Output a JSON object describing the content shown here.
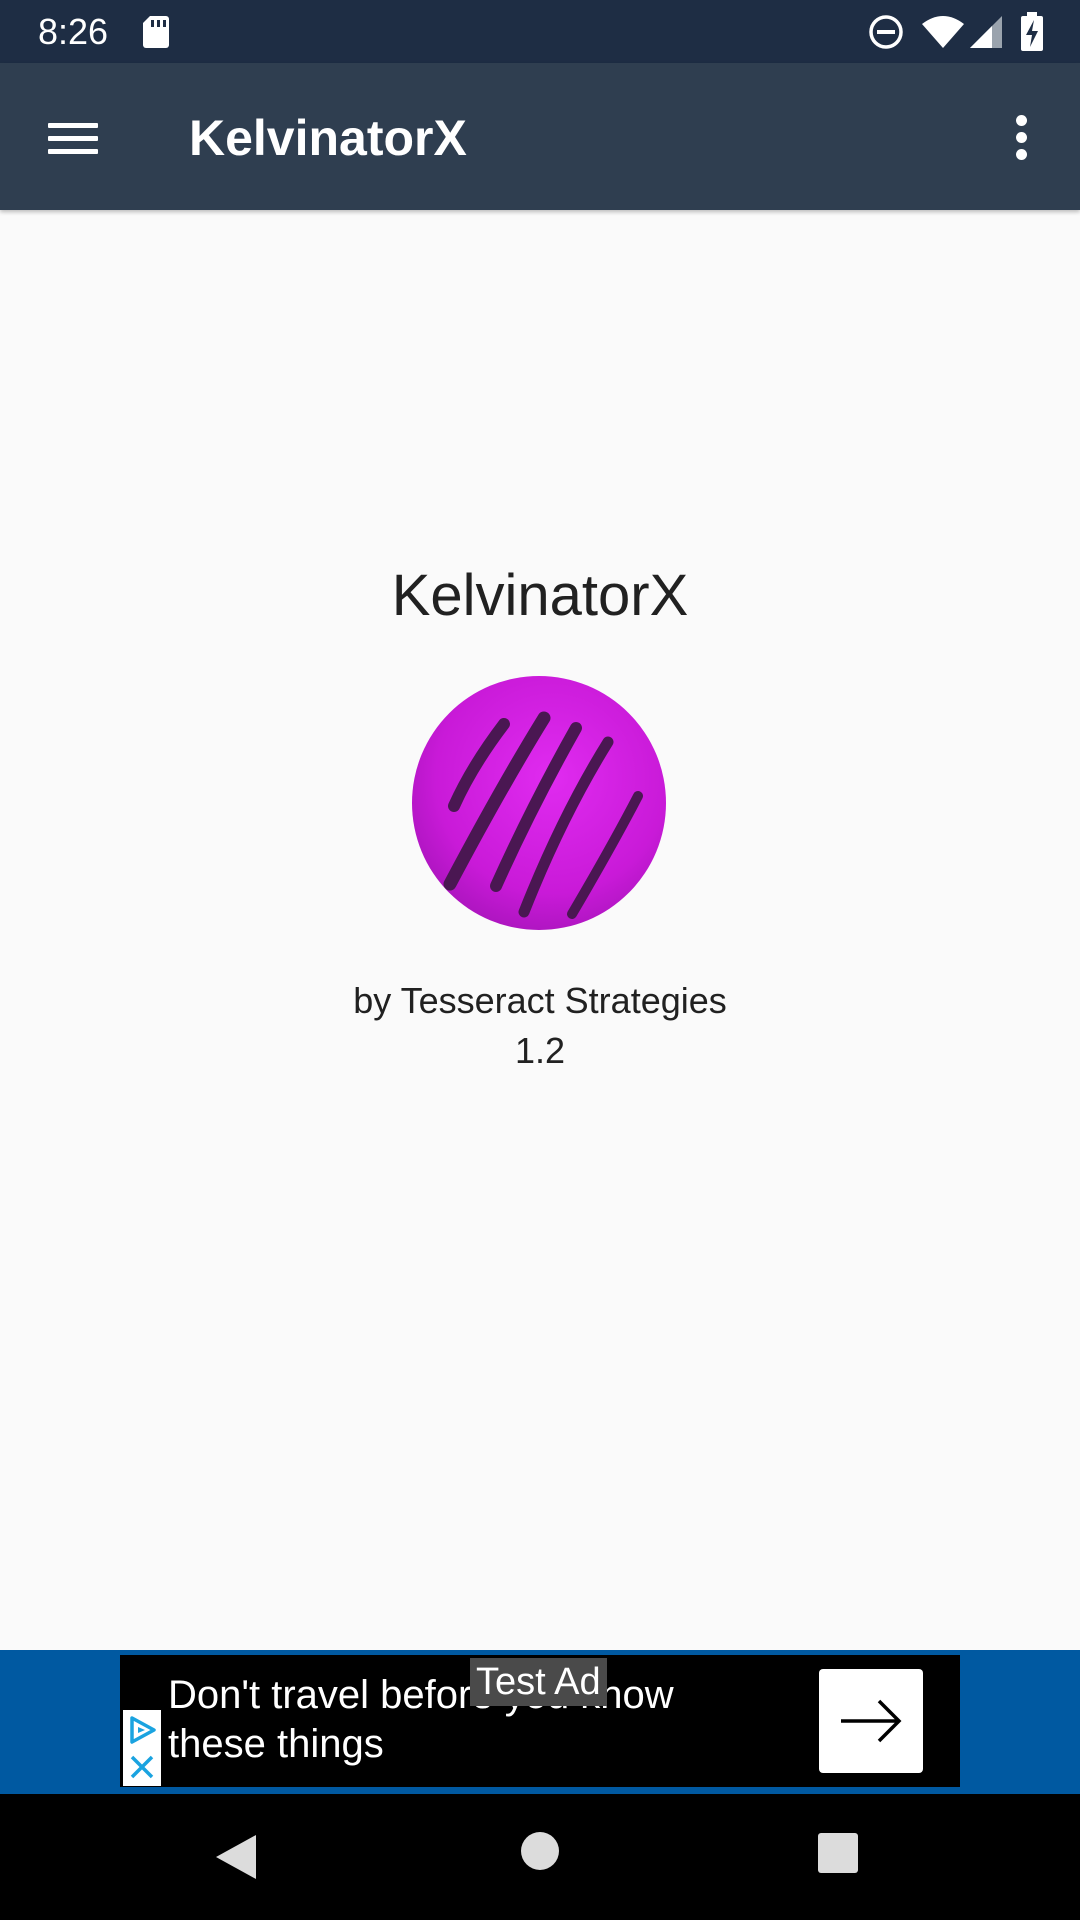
{
  "status_bar": {
    "time": "8:26",
    "icons": [
      "sd-card-icon",
      "do-not-disturb-icon",
      "wifi-icon",
      "cell-signal-icon",
      "battery-charging-icon"
    ]
  },
  "app_bar": {
    "title": "KelvinatorX",
    "menu_icon": "hamburger-menu-icon",
    "overflow_icon": "more-vert-icon"
  },
  "about": {
    "title": "KelvinatorX",
    "logo": "app-logo-icon",
    "developer": "by Tesseract Strategies",
    "version": "1.2"
  },
  "ad": {
    "label": "Test Ad",
    "headline": "Don't travel before you know these things",
    "cta_icon": "arrow-right-icon",
    "choices_icon": "ad-choices-icon"
  },
  "nav_bar": {
    "icons": [
      "back-icon",
      "home-icon",
      "recents-icon"
    ]
  },
  "colors": {
    "status_bar": "#1e2d44",
    "app_bar": "#2f3e50",
    "background": "#fafafa",
    "ad_banner": "#0059a1",
    "logo_accent": "#d21ee0"
  }
}
